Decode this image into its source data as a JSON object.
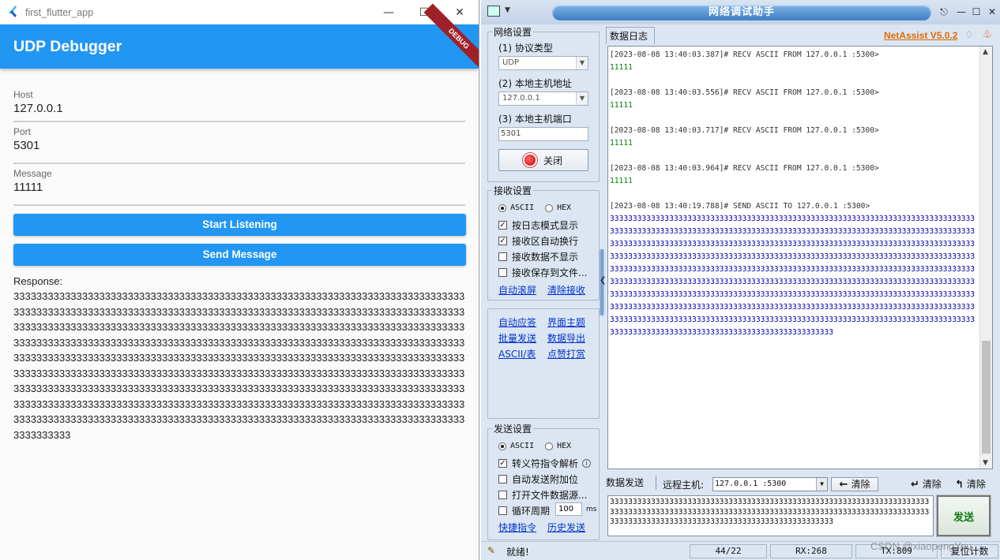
{
  "flutter": {
    "window_title": "first_flutter_app",
    "app_bar_title": "UDP Debugger",
    "debug_banner": "DEBUG",
    "host": {
      "label": "Host",
      "value": "127.0.0.1"
    },
    "port": {
      "label": "Port",
      "value": "5301"
    },
    "message": {
      "label": "Message",
      "value": "11111"
    },
    "start_listening": "Start Listening",
    "send_message": "Send Message",
    "response_label": "Response:",
    "response_text": "3333333333333333333333333333333333333333333333333333333333333333333333333333333333333333333333333333333333333333333333333333333333333333333333333333333333333333333333333333333333333333333333333333333333333333333333333333333333333333333333333333333333333333333333333333333333333333333333333333333333333333333333333333333333333333333333333333333333333333333333333333333333333333333333333333333333333333333333333333333333333333333333333333333333333333333333333333333333333333333333333333333333333333333333333333333333333333333333333333333333333333333333333333333333333333333333333333333333333333333333333333333333333333333333333333333333333333333333333333333333333333333333333333333333333333333333333333333333333333333333333"
  },
  "netassist": {
    "title": "网络调试助手",
    "version": "NetAssist V5.0.2",
    "net_settings": {
      "title": "网络设置",
      "protocol_label": "(1) 协议类型",
      "protocol_value": "UDP",
      "local_addr_label": "(2) 本地主机地址",
      "local_addr_value": "127.0.0.1",
      "local_port_label": "(3) 本地主机端口",
      "local_port_value": "5301",
      "close_button": "关闭"
    },
    "recv_settings": {
      "title": "接收设置",
      "ascii": "ASCII",
      "hex": "HEX",
      "opt1": "按日志模式显示",
      "opt2": "接收区自动换行",
      "opt3": "接收数据不显示",
      "opt4": "接收保存到文件...",
      "link_scroll": "自动滚屏",
      "link_clear": "清除接收"
    },
    "tools": {
      "auto_reply": "自动应答",
      "theme": "界面主题",
      "batch_send": "批量发送",
      "export": "数据导出",
      "ascii_table": "ASCII/表",
      "tip": "点赞打赏"
    },
    "send_settings": {
      "title": "发送设置",
      "ascii": "ASCII",
      "hex": "HEX",
      "opt1": "转义符指令解析",
      "opt2": "自动发送附加位",
      "opt3": "打开文件数据源...",
      "opt4": "循环周期",
      "period_value": "100",
      "period_unit": "ms",
      "link_shortcut": "快捷指令",
      "link_history": "历史发送"
    },
    "log_tab": "数据日志",
    "log": [
      {
        "head": "[2023-08-08 13:40:03.387]# RECV ASCII FROM 127.0.0.1 :5300>",
        "body": "11111"
      },
      {
        "head": "[2023-08-08 13:40:03.556]# RECV ASCII FROM 127.0.0.1 :5300>",
        "body": "11111"
      },
      {
        "head": "[2023-08-08 13:40:03.717]# RECV ASCII FROM 127.0.0.1 :5300>",
        "body": "11111"
      },
      {
        "head": "[2023-08-08 13:40:03.964]# RECV ASCII FROM 127.0.0.1 :5300>",
        "body": "11111"
      },
      {
        "head": "[2023-08-08 13:40:19.788]# SEND ASCII TO 127.0.0.1 :5300>",
        "body": "3333333333333333333333333333333333333333333333333333333333333333333333333333333333333333333333333333333333333333333333333333333333333333333333333333333333333333333333333333333333333333333333333333333333333333333333333333333333333333333333333333333333333333333333333333333333333333333333333333333333333333333333333333333333333333333333333333333333333333333333333333333333333333333333333333333333333333333333333333333333333333333333333333333333333333333333333333333333333333333333333333333333333333333333333333333333333333333333333333333333333333333333333333333333333333333333333333333333333333333333333333333333333333333333333333333333333333333333333333333333333333333333333333333333333333333333333333333333333333333333333333333333333333333333333333333333333333333333333"
      }
    ],
    "send_tab": "数据发送",
    "remote_label": "远程主机:",
    "remote_value": "127.0.0.1 :5300",
    "clear1": "清除",
    "clear2": "清除",
    "clear3": "清除",
    "send_text": "333333333333333333333333333333333333333333333333333333333333333333333333333333333333333333333333333333333333333333333333333333333333333333333333333333333333333333333333333333333333333333333",
    "send_button": "发送",
    "status_text": "就绪!",
    "stat_count": "44/22",
    "stat_rx": "RX:268",
    "stat_tx": "TX:809",
    "stat_reset": "复位计数"
  },
  "watermark": "CSDN @xiaopengYou"
}
